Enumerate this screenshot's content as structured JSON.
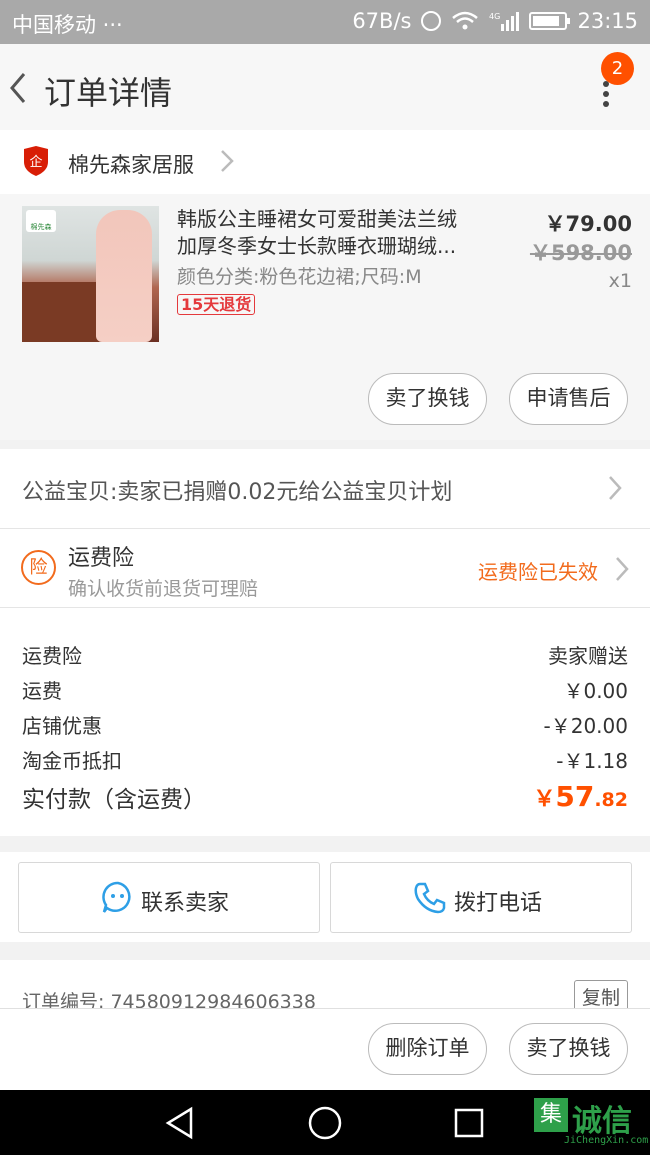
{
  "status_bar": {
    "carrier": "中国移动 ···",
    "speed": "67B/s",
    "network": "4G",
    "time": "23:15"
  },
  "nav": {
    "title": "订单详情",
    "badge": "2"
  },
  "shop": {
    "name": "棉先森家居服"
  },
  "product": {
    "thumb_logo": "棉先森",
    "name_line1": "韩版公主睡裙女可爱甜美法兰绒",
    "name_line2": "加厚冬季女士长款睡衣珊瑚绒...",
    "spec": "颜色分类:粉色花边裙;尺码:M",
    "tag": "15天退货",
    "price": "￥79.00",
    "original_price": "￥598.00",
    "quantity": "x1",
    "sell_label": "卖了换钱",
    "service_label": "申请售后"
  },
  "charity": {
    "text": "公益宝贝:卖家已捐赠0.02元给公益宝贝计划"
  },
  "insurance": {
    "icon_text": "险",
    "title": "运费险",
    "subtitle": "确认收货前退货可理赔",
    "status": "运费险已失效"
  },
  "summary": {
    "rows": [
      {
        "label": "运费险",
        "value": "卖家赠送"
      },
      {
        "label": "运费",
        "value": "￥0.00"
      },
      {
        "label": "店铺优惠",
        "value": "-￥20.00"
      },
      {
        "label": "淘金币抵扣",
        "value": "-￥1.18"
      }
    ],
    "total_label": "实付款（含运费）",
    "total_currency": "￥",
    "total_int": "57",
    "total_dec": ".82"
  },
  "actions": {
    "contact_label": "联系卖家",
    "call_label": "拨打电话"
  },
  "order": {
    "number_text": "订单编号: 74580912984606338",
    "copy_label": "复制"
  },
  "bottom": {
    "delete_label": "删除订单",
    "sell_label": "卖了换钱"
  },
  "watermark": {
    "icon_char": "集",
    "text": "诚信",
    "sub": "JiChengXin.com"
  },
  "colors": {
    "accent": "#ff5000",
    "insurance": "#f26b1d",
    "tag_red": "#e4393c",
    "chat_blue": "#2e9fe6"
  }
}
